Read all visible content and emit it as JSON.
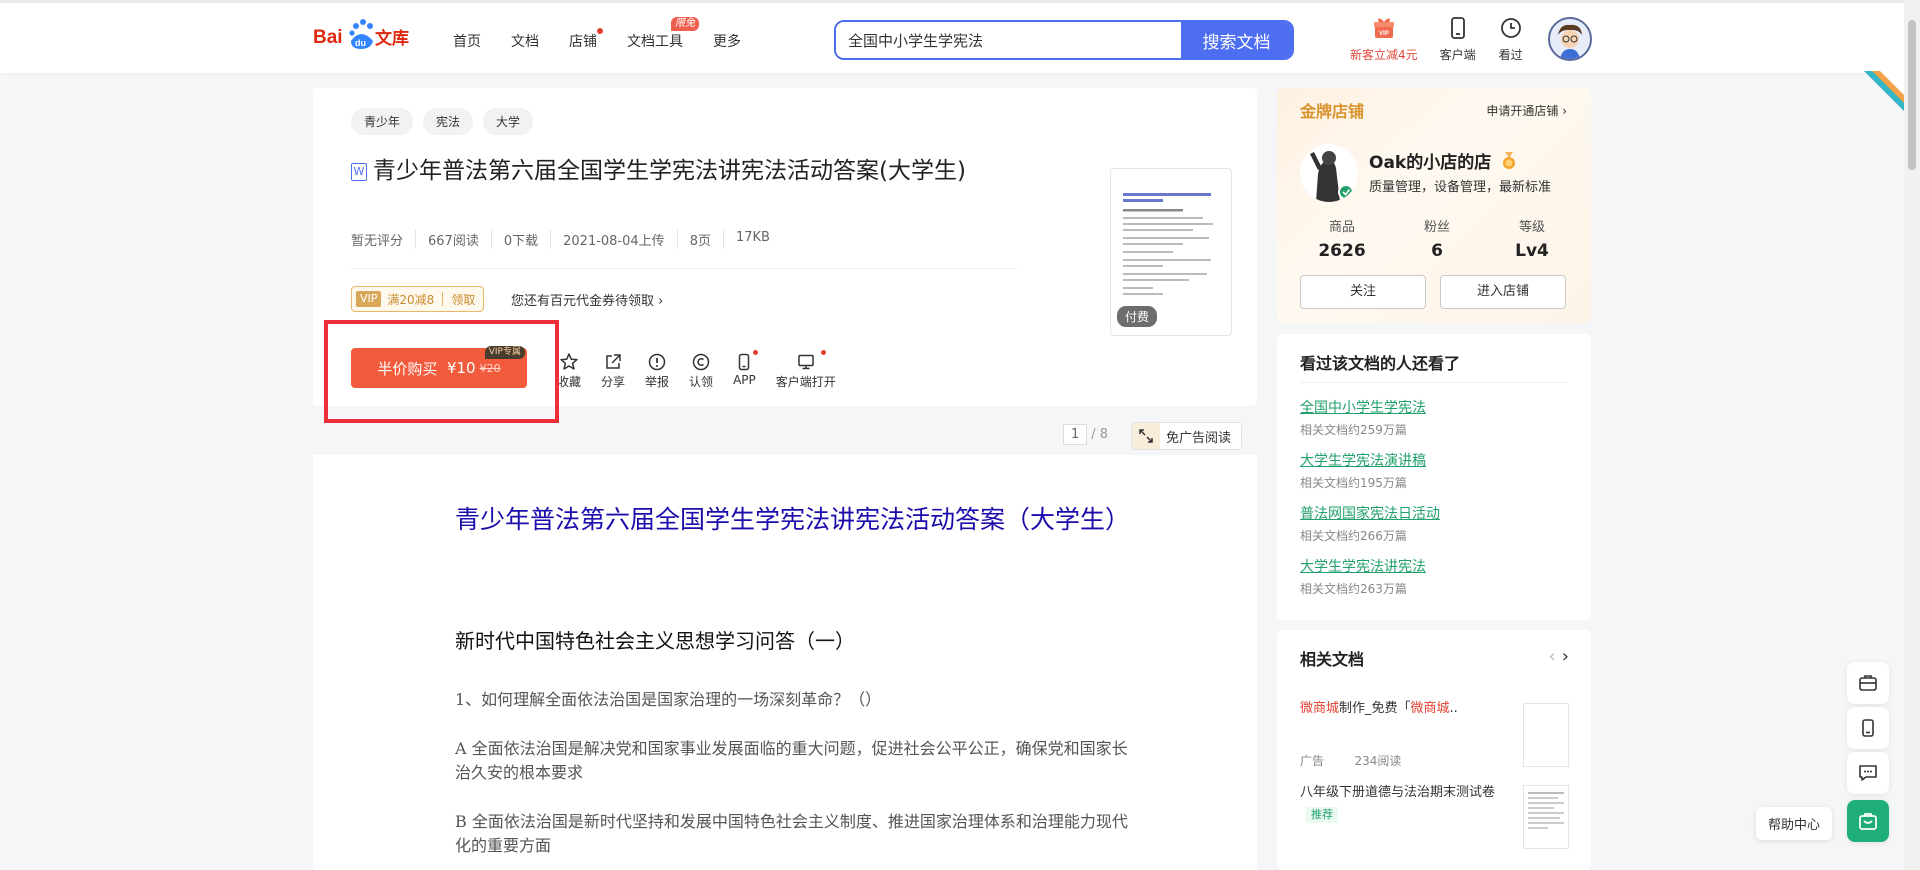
{
  "header": {
    "logo": {
      "bai": "Bai",
      "du": "du",
      "wenku": "文库"
    },
    "nav": [
      {
        "label": "首页"
      },
      {
        "label": "文档"
      },
      {
        "label": "店铺"
      },
      {
        "label": "文档工具",
        "badge": "限免"
      },
      {
        "label": "更多"
      }
    ],
    "search": {
      "value": "全国中小学生学宪法",
      "button": "搜索文档"
    },
    "icons": [
      {
        "label": "新客立减4元",
        "icon": "vip-gift-icon"
      },
      {
        "label": "客户端",
        "icon": "phone-icon"
      },
      {
        "label": "看过",
        "icon": "clock-icon"
      }
    ]
  },
  "doc": {
    "tags": [
      "青少年",
      "宪法",
      "大学"
    ],
    "type_icon": "W",
    "title": "青少年普法第六届全国学生学宪法讲宪法活动答案(大学生)",
    "meta": [
      "暂无评分",
      "667阅读",
      "0下载",
      "2021-08-04上传",
      "8页",
      "17KB"
    ],
    "coupon": {
      "vip": "VIP",
      "text": "满20减8",
      "action": "领取"
    },
    "coupon_tip": "您还有百元代金券待领取 ›",
    "buy": {
      "label": "半价购买",
      "price": "¥10",
      "old_price": "¥20",
      "flag": "VIP专属"
    },
    "actions": [
      {
        "label": "收藏",
        "icon": "star-icon"
      },
      {
        "label": "分享",
        "icon": "share-icon"
      },
      {
        "label": "举报",
        "icon": "report-icon"
      },
      {
        "label": "认领",
        "icon": "copyright-icon"
      },
      {
        "label": "APP",
        "icon": "phone-icon"
      },
      {
        "label": "客户端打开",
        "icon": "monitor-icon"
      }
    ],
    "thumb_badge": "付费"
  },
  "reader": {
    "page_current": "1",
    "page_total": "/ 8",
    "noad": "免广告阅读"
  },
  "page": {
    "title": "青少年普法第六届全国学生学宪法讲宪法活动答案（大学生）",
    "subtitle": "新时代中国特色社会主义思想学习问答（一）",
    "paragraphs": [
      "1、如何理解全面依法治国是国家治理的一场深刻革命？（）",
      "A 全面依法治国是解决党和国家事业发展面临的重大问题，促进社会公平公正，确保党和国家长治久安的根本要求",
      "B 全面依法治国是新时代坚持和发展中国特色社会主义制度、推进国家治理体系和治理能力现代化的重要方面"
    ]
  },
  "shop": {
    "label": "金牌店铺",
    "apply": "申请开通店铺 ›",
    "name": "Oak的小店的店",
    "desc": "质量管理，设备管理，最新标准",
    "stats": [
      {
        "k": "商品",
        "v": "2626"
      },
      {
        "k": "粉丝",
        "v": "6"
      },
      {
        "k": "等级",
        "v": "Lv4"
      }
    ],
    "follow": "关注",
    "enter": "进入店铺"
  },
  "also": {
    "title": "看过该文档的人还看了",
    "items": [
      {
        "t": "全国中小学生学宪法",
        "s": "相关文档约259万篇"
      },
      {
        "t": "大学生学宪法演讲稿",
        "s": "相关文档约195万篇"
      },
      {
        "t": "普法网国家宪法日活动",
        "s": "相关文档约266万篇"
      },
      {
        "t": "大学生学宪法讲宪法",
        "s": "相关文档约263万篇"
      }
    ]
  },
  "related": {
    "title": "相关文档",
    "item1": {
      "hl1": "微商城",
      "mid": "制作_免费「",
      "hl2": "微商城",
      "tail": "..",
      "ad": "广告",
      "reads": "234阅读"
    },
    "item2": {
      "t": "八年级下册道德与法治期末测试卷",
      "rec": "推荐"
    }
  },
  "float": {
    "help": "帮助中心"
  }
}
